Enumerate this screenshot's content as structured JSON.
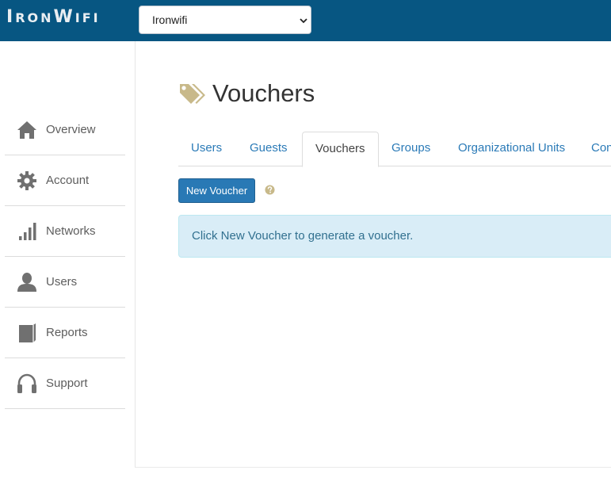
{
  "header": {
    "logo_first": "I",
    "logo_rest1": "RON",
    "logo_cap2": "W",
    "logo_rest2": "IFI",
    "org_select_value": "Ironwifi"
  },
  "sidebar": {
    "items": [
      {
        "label": "Overview",
        "icon": "home-icon"
      },
      {
        "label": "Account",
        "icon": "gear-icon"
      },
      {
        "label": "Networks",
        "icon": "signal-bars-icon"
      },
      {
        "label": "Users",
        "icon": "user-icon"
      },
      {
        "label": "Reports",
        "icon": "book-icon"
      },
      {
        "label": "Support",
        "icon": "headphones-icon"
      }
    ]
  },
  "main": {
    "title": "Vouchers",
    "title_icon": "tags-icon",
    "tabs": [
      {
        "label": "Users"
      },
      {
        "label": "Guests"
      },
      {
        "label": "Vouchers",
        "active": true
      },
      {
        "label": "Groups"
      },
      {
        "label": "Organizational Units"
      },
      {
        "label": "Con"
      }
    ],
    "new_voucher_label": "New Voucher",
    "help_icon": "question-circle-icon",
    "info_message": "Click New Voucher to generate a voucher."
  },
  "colors": {
    "topbar": "#075682",
    "primary_button": "#2979b5",
    "link": "#2a7ab7",
    "info_bg": "#d9edf7",
    "info_text": "#31708f",
    "icon_gray": "#707070",
    "tag_icon": "#c8b98a"
  }
}
